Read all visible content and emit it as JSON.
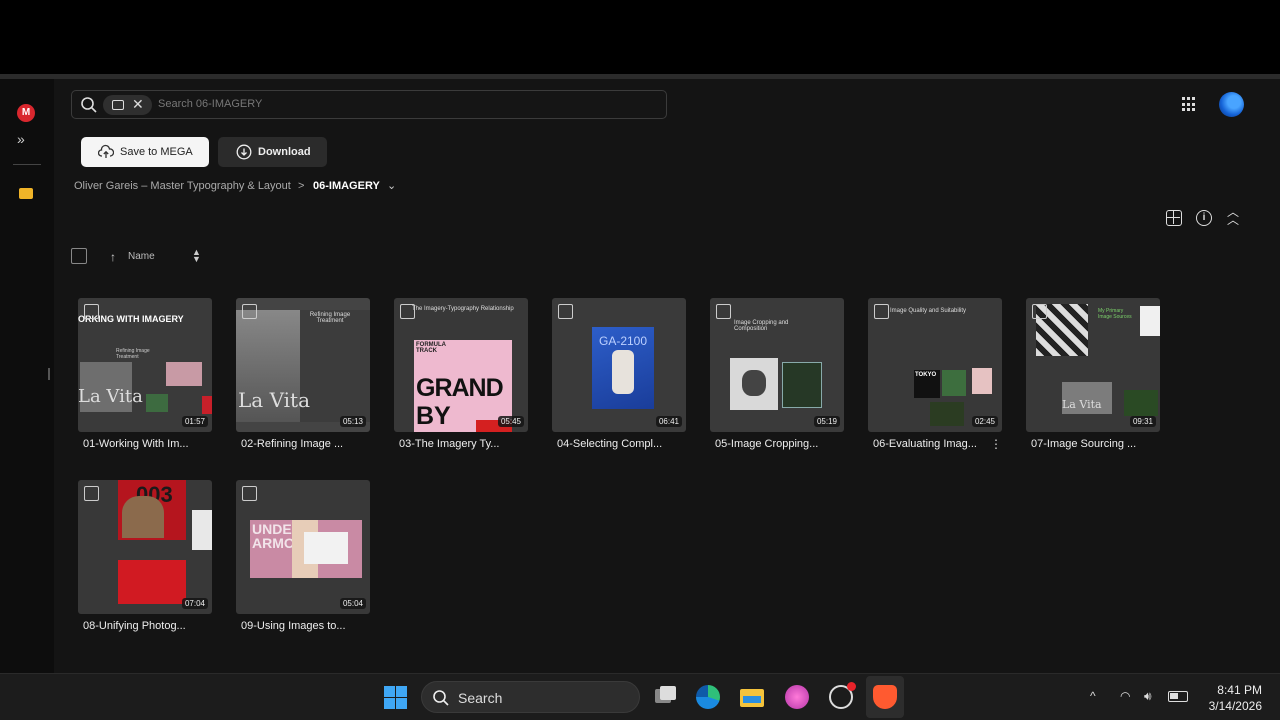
{
  "search": {
    "placeholder": "Search 06-IMAGERY"
  },
  "actions": {
    "save_label": "Save to MEGA",
    "download_label": "Download"
  },
  "breadcrumb": {
    "parent": "Oliver Gareis – Master Typography & Layout",
    "separator": ">",
    "current": "06-IMAGERY"
  },
  "sort": {
    "label": "Name"
  },
  "files": [
    {
      "name": "01-Working With Im...",
      "duration": "01:57"
    },
    {
      "name": "02-Refining Image ...",
      "duration": "05:13"
    },
    {
      "name": "03-The Imagery Ty...",
      "duration": "05:45"
    },
    {
      "name": "04-Selecting Compl...",
      "duration": "06:41"
    },
    {
      "name": "05-Image Cropping...",
      "duration": "05:19"
    },
    {
      "name": "06-Evaluating Imag...",
      "duration": "02:45"
    },
    {
      "name": "07-Image Sourcing ...",
      "duration": "09:31"
    },
    {
      "name": "08-Unifying Photog...",
      "duration": "07:04"
    },
    {
      "name": "09-Using Images to...",
      "duration": "05:04"
    }
  ],
  "thumb_text": {
    "t1_title": "ORKING WITH IMAGERY",
    "t1_sub": "Refining Image Treatment",
    "t1_overlay": "La Vita",
    "t2_title": "Refining Image Treatment",
    "t2_overlay": "La Vita",
    "t3_title": "The Imagery-Typography Relationship",
    "t3_big": "GRAND",
    "t3_big2": "BY",
    "t3_small": "FORMULA TRACK",
    "t4_text": "GA-2100",
    "t5_title": "Image Cropping and Composition",
    "t6_title": "Image Quality and Suitability",
    "t6_tag": "TOKYO",
    "t7_title": "My Primary Image Sources",
    "t7_overlay": "La Vita",
    "t8_big": "003",
    "t9_big": "UNDER ARMOUR"
  },
  "taskbar": {
    "search_label": "Search",
    "time": "8:41 PM",
    "date": "3/14/2026"
  },
  "colors": {
    "accent": "#d9272e",
    "folder": "#f0b428",
    "windows_blue": "#3fa7f5"
  }
}
